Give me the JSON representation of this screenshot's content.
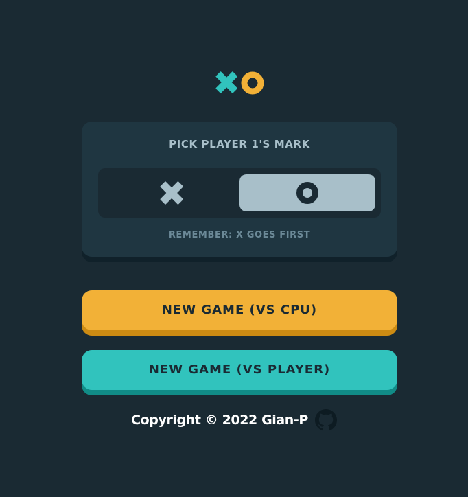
{
  "logo": {
    "icons": [
      "x-mark-icon",
      "o-mark-icon"
    ],
    "colors": {
      "x": "#31c3bd",
      "o": "#f2b137"
    }
  },
  "mark_picker": {
    "title": "PICK PLAYER 1'S MARK",
    "options": [
      {
        "mark": "X",
        "icon": "x-mark-icon",
        "selected": false
      },
      {
        "mark": "O",
        "icon": "o-mark-icon",
        "selected": true
      }
    ],
    "hint": "REMEMBER: X GOES FIRST"
  },
  "buttons": {
    "new_game_cpu": "NEW GAME (VS CPU)",
    "new_game_player": "NEW GAME (VS PLAYER)"
  },
  "footer": {
    "copyright": "Copyright © 2022 Gian-P",
    "link_icon": "github-icon"
  },
  "colors": {
    "background": "#1a2a33",
    "panel": "#1f3641",
    "silver": "#a8bfc9",
    "yellow": "#f2b137",
    "teal": "#31c3bd"
  }
}
